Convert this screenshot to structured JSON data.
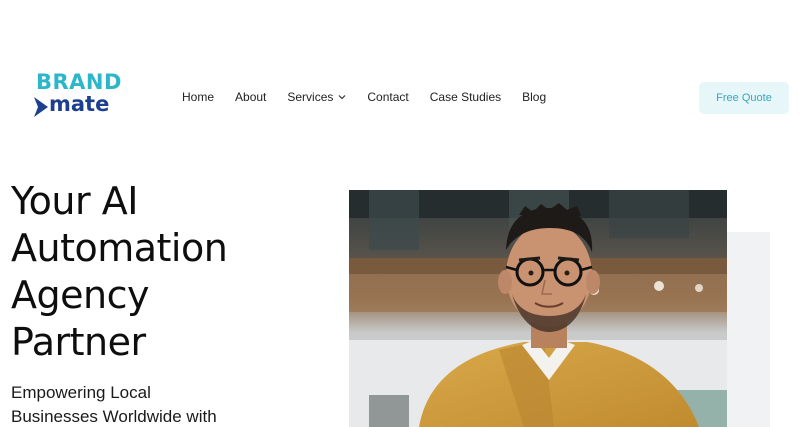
{
  "logo": {
    "line1": "BRAND",
    "line2": "mate",
    "icon": "arrow-icon",
    "colors": {
      "brand": "#2bb6c9",
      "mate": "#1d3f8f"
    }
  },
  "nav": {
    "items": [
      {
        "label": "Home"
      },
      {
        "label": "About"
      },
      {
        "label": "Services",
        "icon": "chevron-down-icon"
      },
      {
        "label": "Contact"
      },
      {
        "label": "Case Studies"
      },
      {
        "label": "Blog"
      }
    ]
  },
  "cta": {
    "label": "Free Quote",
    "colors": {
      "bg": "#e6f6f9",
      "text": "#3aa6b9"
    }
  },
  "hero": {
    "headline_lines": [
      "Your AI",
      "Automation",
      "Agency",
      "Partner"
    ],
    "subtitle_lines": [
      "Empowering Local",
      "Businesses Worldwide with"
    ]
  }
}
